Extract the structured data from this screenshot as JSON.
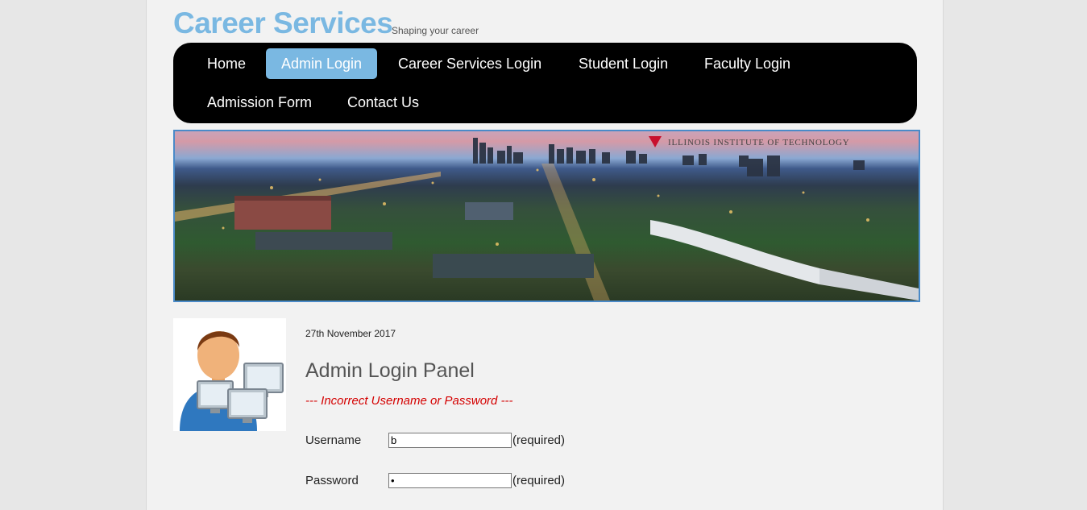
{
  "header": {
    "title": "Career Services",
    "tagline": "Shaping your career"
  },
  "nav": {
    "items": [
      {
        "label": "Home",
        "active": false
      },
      {
        "label": "Admin Login",
        "active": true
      },
      {
        "label": "Career Services Login",
        "active": false
      },
      {
        "label": "Student Login",
        "active": false
      },
      {
        "label": "Faculty Login",
        "active": false
      },
      {
        "label": "Admission Form",
        "active": false
      },
      {
        "label": "Contact Us",
        "active": false
      }
    ]
  },
  "banner": {
    "caption": "ILLINOIS INSTITUTE OF TECHNOLOGY"
  },
  "main": {
    "date": "27th November 2017",
    "panel_title": "Admin Login Panel",
    "error_message": "--- Incorrect Username or Password ---",
    "username": {
      "label": "Username",
      "value": "b",
      "required_text": "(required)"
    },
    "password": {
      "label": "Password",
      "value": "b",
      "required_text": "(required)"
    }
  },
  "colors": {
    "accent": "#7ab8e2",
    "nav_bg": "#000000",
    "error": "#d40000",
    "banner_border": "#4a8ac8"
  }
}
